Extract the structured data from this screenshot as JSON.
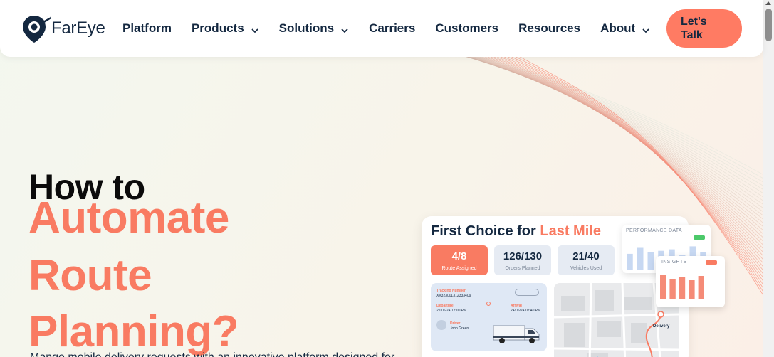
{
  "brand": {
    "name": "FarEye",
    "accent": "#f97b62",
    "navy": "#142840"
  },
  "nav": {
    "items": [
      {
        "label": "Platform",
        "has_dropdown": false
      },
      {
        "label": "Products",
        "has_dropdown": true
      },
      {
        "label": "Solutions",
        "has_dropdown": true
      },
      {
        "label": "Carriers",
        "has_dropdown": false
      },
      {
        "label": "Customers",
        "has_dropdown": false
      },
      {
        "label": "Resources",
        "has_dropdown": false
      },
      {
        "label": "About",
        "has_dropdown": true
      }
    ],
    "cta_line1": "Let's",
    "cta_line2": "Talk"
  },
  "hero": {
    "line1": "How to",
    "accent_lines": [
      "Automate",
      "Route",
      "Planning?"
    ],
    "subtext": "Mange mobile delivery requests with an innovative platform designed for..."
  },
  "dashboard": {
    "title_plain": "First Choice for ",
    "title_highlight": "Last Mile",
    "stats": [
      {
        "value": "4/8",
        "label": "Route Assigned",
        "active": true
      },
      {
        "value": "126/130",
        "label": "Orders Planned",
        "active": false
      },
      {
        "value": "21/40",
        "label": "Vehicles Used",
        "active": false
      }
    ],
    "tracking": {
      "number_label": "Tracking Number",
      "number_value": "XX32300L312333409",
      "departure_label": "Departure",
      "departure_value": "22/06/24 12:00 PM",
      "arrival_label": "Arrival",
      "arrival_value": "24/06/24 02:40 PM",
      "driver_label": "Driver",
      "driver_value": "John Green"
    },
    "map_label": "Delivery",
    "performance_title": "PERFORMANCE DATA",
    "performance_values": [
      0.55,
      0.75,
      0.6,
      0.65,
      0.7,
      0.5,
      0.8,
      0.6
    ],
    "insights_title": "INSIGHTS",
    "insights_values": [
      0.85,
      0.7,
      0.75,
      0.65,
      0.8
    ]
  },
  "icons": [
    "fareye-logo-icon",
    "chevron-down-icon",
    "scroll-up-icon",
    "map-pin-icon",
    "van-icon",
    "driver-avatar-icon"
  ]
}
